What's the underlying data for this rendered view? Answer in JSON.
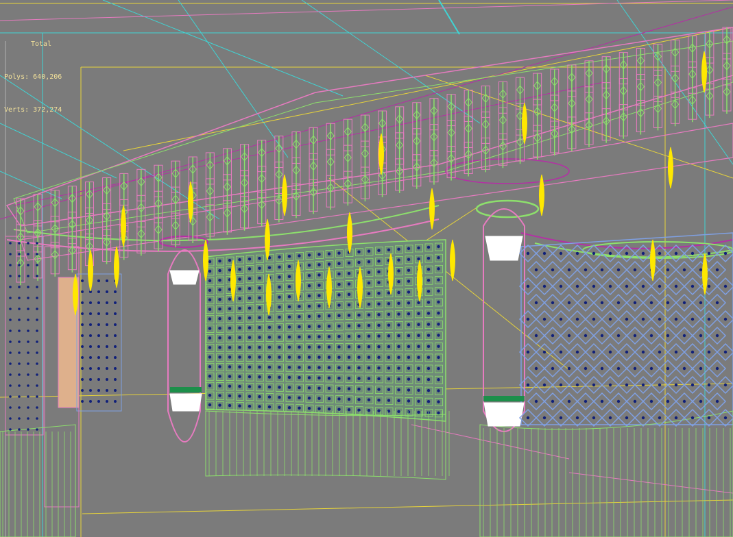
{
  "viewport": {
    "stats": {
      "title": "Total",
      "polys_label": "Polys:",
      "polys_value": "640,206",
      "verts_label": "Verts:",
      "verts_value": "372,274"
    },
    "colors": {
      "background": "#7b7b7b",
      "stats_text": "#f2e19a",
      "wire_cyan": "#3fd5d5",
      "wire_yellow": "#e8d43a",
      "wire_pink": "#e77bc0",
      "wire_magenta": "#b42fa5",
      "wire_green": "#8de06c",
      "wire_blue": "#7fa0e3",
      "light_yellow": "#ffe800",
      "vertex_blue": "#10207a",
      "skin": "#deb08c",
      "lamp_white": "#ffffff",
      "lamp_green": "#1c8f4a"
    }
  }
}
